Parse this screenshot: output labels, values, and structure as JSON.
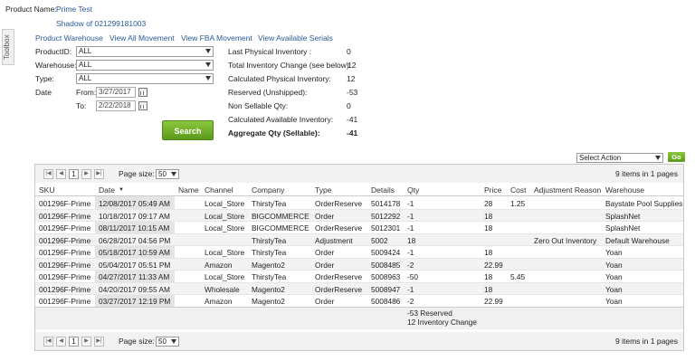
{
  "product": {
    "name_label": "Product Name:",
    "name_value": "Prime Test",
    "shadow": "Shadow of 021299181003"
  },
  "links": [
    "Product Warehouse",
    "View All Movement",
    "View FBA Movement",
    "View Available Serials"
  ],
  "toolbox_label": "Toolbox",
  "filters": {
    "productid_label": "ProductID:",
    "productid_value": "ALL",
    "warehouse_label": "Warehouse:",
    "warehouse_value": "ALL",
    "type_label": "Type:",
    "type_value": "ALL",
    "date_label": "Date",
    "from_label": "From:",
    "from_value": "3/27/2017",
    "to_label": "To:",
    "to_value": "2/22/2018",
    "search_label": "Search"
  },
  "stats": [
    {
      "label": "Last Physical Inventory :",
      "value": "0"
    },
    {
      "label": "Total Inventory Change (see below):",
      "value": "12"
    },
    {
      "label": "Calculated Physical Inventory:",
      "value": "12"
    },
    {
      "label": "Reserved (Unshipped):",
      "value": "-53"
    },
    {
      "label": "Non Sellable Qty:",
      "value": "0"
    },
    {
      "label": "Calculated Available Inventory:",
      "value": "-41"
    },
    {
      "label": "Aggregate Qty (Sellable):",
      "value": "-41"
    }
  ],
  "action": {
    "select_value": "Select Action",
    "go_label": "Go"
  },
  "pager": {
    "page": "1",
    "page_size_label": "Page size:",
    "page_size": "50",
    "items_info": "9 items in 1 pages"
  },
  "columns": [
    "SKU",
    "Date",
    "Name",
    "Channel",
    "Company",
    "Type",
    "Details",
    "Qty",
    "Price",
    "Cost",
    "Adjustment Reason",
    "Warehouse"
  ],
  "rows": [
    [
      "001296F-Prime",
      "12/08/2017 05:49 AM",
      "",
      "Local_Store",
      "ThirstyTea",
      "OrderReserve",
      "5014178",
      "-1",
      "28",
      "1.25",
      "",
      "Baystate Pool Supplies"
    ],
    [
      "001296F-Prime",
      "10/18/2017 09:17 AM",
      "",
      "Local_Store",
      "BIGCOMMERCE",
      "Order",
      "5012292",
      "-1",
      "18",
      "",
      "",
      "SplashNet"
    ],
    [
      "001296F-Prime",
      "08/11/2017 10:15 AM",
      "",
      "Local_Store",
      "BIGCOMMERCE",
      "OrderReserve",
      "5012301",
      "-1",
      "18",
      "",
      "",
      "SplashNet"
    ],
    [
      "001296F-Prime",
      "06/28/2017 04:56 PM",
      "",
      "",
      "ThirstyTea",
      "Adjustment",
      "5002",
      "18",
      "",
      "",
      "Zero Out Inventory",
      "Default Warehouse"
    ],
    [
      "001296F-Prime",
      "05/18/2017 10:59 AM",
      "",
      "Local_Store",
      "ThirstyTea",
      "Order",
      "5009424",
      "-1",
      "18",
      "",
      "",
      "Yoan"
    ],
    [
      "001296F-Prime",
      "05/04/2017 05:51 PM",
      "",
      "Amazon",
      "Magento2",
      "Order",
      "5008485",
      "-2",
      "22.99",
      "",
      "",
      "Yoan"
    ],
    [
      "001296F-Prime",
      "04/27/2017 11:33 AM",
      "",
      "Local_Store",
      "ThirstyTea",
      "OrderReserve",
      "5008963",
      "-50",
      "18",
      "5.45",
      "",
      "Yoan"
    ],
    [
      "001296F-Prime",
      "04/20/2017 09:55 AM",
      "",
      "Wholesale",
      "Magento2",
      "OrderReserve",
      "5008947",
      "-1",
      "18",
      "",
      "",
      "Yoan"
    ],
    [
      "001296F-Prime",
      "03/27/2017 12:19 PM",
      "",
      "Amazon",
      "Magento2",
      "Order",
      "5008486",
      "-2",
      "22.99",
      "",
      "",
      "Yoan"
    ]
  ],
  "summary": {
    "reserved": "-53 Reserved",
    "change": "12 Inventory Change"
  }
}
